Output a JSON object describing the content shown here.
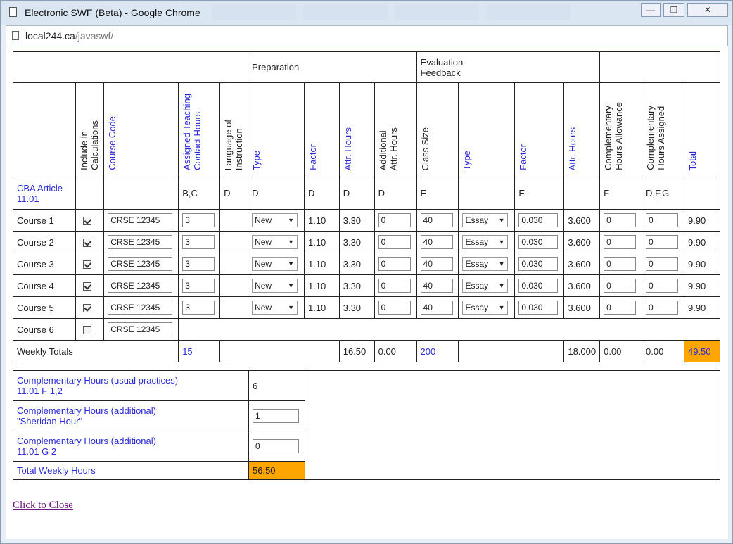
{
  "window": {
    "title": "Electronic SWF (Beta) - Google Chrome",
    "url_host": "local244.ca",
    "url_path": "/javaswf/"
  },
  "header": {
    "preparation": "Preparation",
    "evaluation": "Evaluation Feedback"
  },
  "columns": {
    "include": "Include in\nCalculations",
    "course_code": "Course Code",
    "assigned": "Assigned Teaching\nContact Hours",
    "language": "Language of\nInstruction",
    "prep_type": "Type",
    "prep_factor": "Factor",
    "prep_attr": "Attr. Hours",
    "additional": "Additional\nAttr. Hours",
    "class_size": "Class Size",
    "eval_type": "Type",
    "eval_factor": "Factor",
    "eval_attr": "Attr. Hours",
    "comp_allow": "Complementary\nHours Allowance",
    "comp_assigned": "Complementary\nHours Assigned",
    "total": "Total"
  },
  "cba": {
    "label": "CBA Article\n11.01",
    "assigned": "B,C",
    "language": "D",
    "prep_type": "D",
    "prep_factor": "D",
    "prep_attr": "D",
    "additional": "D",
    "class_size": "E",
    "eval_factor": "E",
    "comp_allow": "F",
    "comp_assigned": "D,F,G"
  },
  "rows": [
    {
      "label": "Course 1",
      "checked": true,
      "code": "CRSE 12345",
      "hours": "3",
      "type": "New",
      "factor": "1.10",
      "attr": "3.30",
      "additional": "0",
      "size": "40",
      "etype": "Essay",
      "efactor": "0.030",
      "eattr": "3.600",
      "callow": "0",
      "cassigned": "0",
      "total": "9.90"
    },
    {
      "label": "Course 2",
      "checked": true,
      "code": "CRSE 12345",
      "hours": "3",
      "type": "New",
      "factor": "1.10",
      "attr": "3.30",
      "additional": "0",
      "size": "40",
      "etype": "Essay",
      "efactor": "0.030",
      "eattr": "3.600",
      "callow": "0",
      "cassigned": "0",
      "total": "9.90"
    },
    {
      "label": "Course 3",
      "checked": true,
      "code": "CRSE 12345",
      "hours": "3",
      "type": "New",
      "factor": "1.10",
      "attr": "3.30",
      "additional": "0",
      "size": "40",
      "etype": "Essay",
      "efactor": "0.030",
      "eattr": "3.600",
      "callow": "0",
      "cassigned": "0",
      "total": "9.90"
    },
    {
      "label": "Course 4",
      "checked": true,
      "code": "CRSE 12345",
      "hours": "3",
      "type": "New",
      "factor": "1.10",
      "attr": "3.30",
      "additional": "0",
      "size": "40",
      "etype": "Essay",
      "efactor": "0.030",
      "eattr": "3.600",
      "callow": "0",
      "cassigned": "0",
      "total": "9.90"
    },
    {
      "label": "Course 5",
      "checked": true,
      "code": "CRSE 12345",
      "hours": "3",
      "type": "New",
      "factor": "1.10",
      "attr": "3.30",
      "additional": "0",
      "size": "40",
      "etype": "Essay",
      "efactor": "0.030",
      "eattr": "3.600",
      "callow": "0",
      "cassigned": "0",
      "total": "9.90"
    }
  ],
  "row6": {
    "label": "Course 6",
    "checked": false,
    "code": "CRSE 12345"
  },
  "totals": {
    "label": "Weekly Totals",
    "hours": "15",
    "attr": "16.50",
    "additional": "0.00",
    "size": "200",
    "eattr": "18.000",
    "callow": "0.00",
    "cassigned": "0.00",
    "total": "49.50"
  },
  "summary": {
    "usual_label": "Complementary Hours (usual practices)\n11.01 F 1,2",
    "usual_value": "6",
    "sheridan_label": "Complementary Hours (additional)\n\"Sheridan Hour\"",
    "sheridan_value": "1",
    "g2_label": "Complementary Hours (additional)\n11.01 G 2",
    "g2_value": "0",
    "total_label": "Total Weekly Hours",
    "total_value": "56.50"
  },
  "close_link": "Click to Close ",
  "colors": {
    "accent": "#2b2bd6",
    "highlight": "#ffa500"
  },
  "icons": {
    "page": "page-icon",
    "minimize": "minimize-icon",
    "maximize": "maximize-icon",
    "close": "close-icon"
  }
}
